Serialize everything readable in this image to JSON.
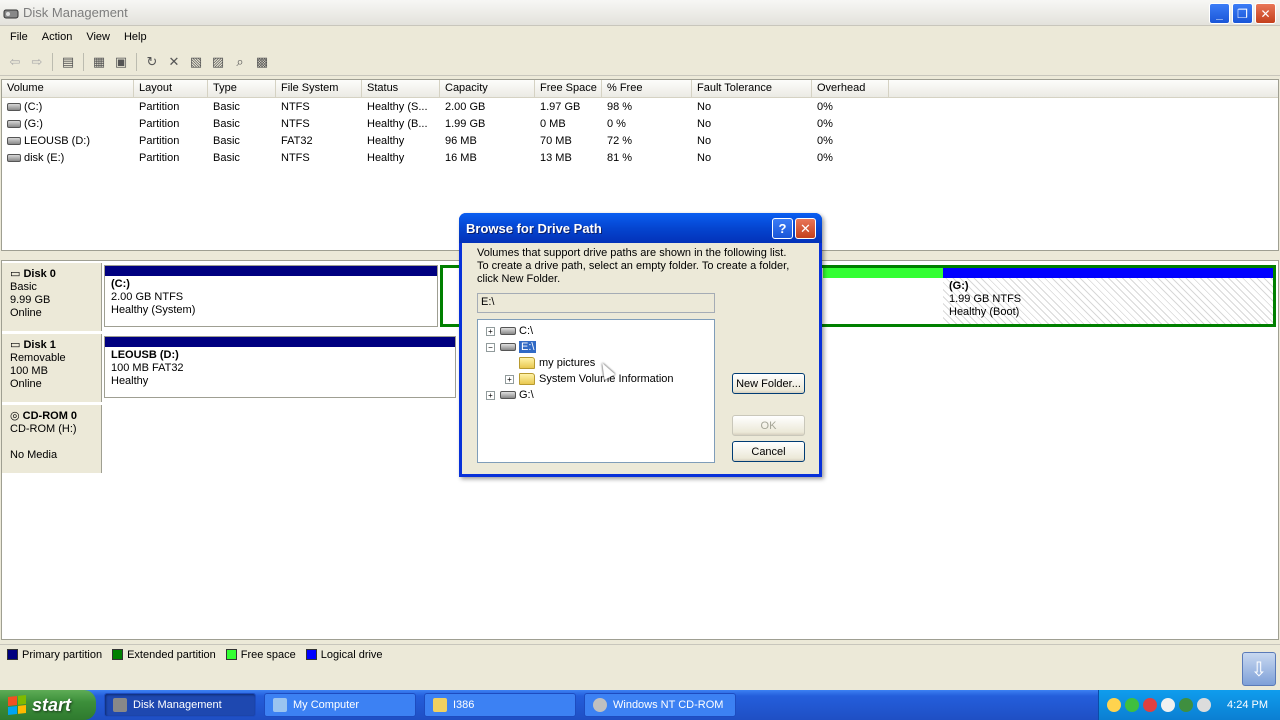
{
  "window": {
    "title": "Disk Management"
  },
  "menu": [
    "File",
    "Action",
    "View",
    "Help"
  ],
  "list": {
    "columns": [
      "Volume",
      "Layout",
      "Type",
      "File System",
      "Status",
      "Capacity",
      "Free Space",
      "% Free",
      "Fault Tolerance",
      "Overhead"
    ],
    "rows": [
      [
        "(C:)",
        "Partition",
        "Basic",
        "NTFS",
        "Healthy (S...",
        "2.00 GB",
        "1.97 GB",
        "98 %",
        "No",
        "0%"
      ],
      [
        "(G:)",
        "Partition",
        "Basic",
        "NTFS",
        "Healthy (B...",
        "1.99 GB",
        "0 MB",
        "0 %",
        "No",
        "0%"
      ],
      [
        "LEOUSB (D:)",
        "Partition",
        "Basic",
        "FAT32",
        "Healthy",
        "96 MB",
        "70 MB",
        "72 %",
        "No",
        "0%"
      ],
      [
        "disk (E:)",
        "Partition",
        "Basic",
        "NTFS",
        "Healthy",
        "16 MB",
        "13 MB",
        "81 %",
        "No",
        "0%"
      ]
    ]
  },
  "disks": [
    {
      "name": "Disk 0",
      "lines": [
        "Basic",
        "9.99 GB",
        "Online"
      ]
    },
    {
      "name": "Disk 1",
      "lines": [
        "Removable",
        "100 MB",
        "Online"
      ]
    },
    {
      "name": "CD-ROM 0",
      "lines": [
        "CD-ROM (H:)",
        "",
        "No Media"
      ]
    }
  ],
  "partitions": {
    "c": {
      "name": "(C:)",
      "size": "2.00 GB NTFS",
      "status": "Healthy (System)"
    },
    "g": {
      "name": "(G:)",
      "size": "1.99 GB NTFS",
      "status": "Healthy (Boot)"
    },
    "d": {
      "name": "LEOUSB  (D:)",
      "size": "100 MB FAT32",
      "status": "Healthy"
    }
  },
  "legend": [
    {
      "label": "Primary partition",
      "color": "#000080"
    },
    {
      "label": "Extended partition",
      "color": "#008000"
    },
    {
      "label": "Free space",
      "color": "#33ff33"
    },
    {
      "label": "Logical drive",
      "color": "#0000ff"
    }
  ],
  "dialog": {
    "title": "Browse for Drive Path",
    "desc1": "Volumes that support drive paths are shown in the following list.",
    "desc2": "To create a drive path, select an empty folder. To create a folder,",
    "desc3": "click New Folder.",
    "path_value": "E:\\",
    "tree": {
      "c": "C:\\",
      "e": "E:\\",
      "my_pictures": "my pictures",
      "svi": "System Volume Information",
      "g": "G:\\"
    },
    "new_folder": "New Folder...",
    "ok": "OK",
    "cancel": "Cancel"
  },
  "taskbar": {
    "start": "start",
    "tasks": [
      "Disk Management",
      "My Computer",
      "I386",
      "Windows NT CD-ROM"
    ],
    "clock": "4:24 PM"
  }
}
